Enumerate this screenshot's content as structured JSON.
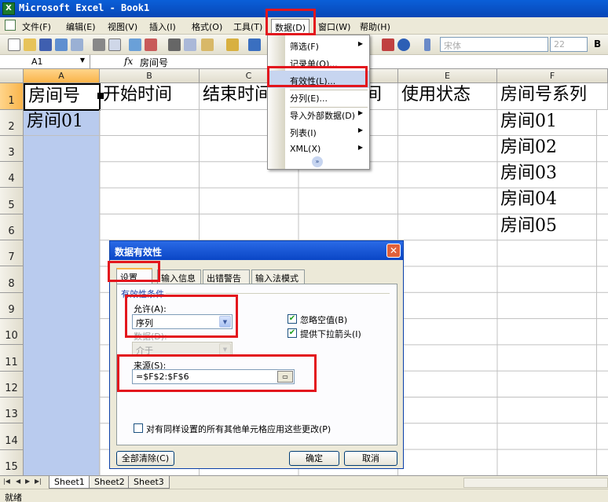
{
  "window": {
    "title": "Microsoft Excel - Book1",
    "app_icon": "X"
  },
  "menubar": {
    "items": [
      {
        "label": "文件(F)"
      },
      {
        "label": "编辑(E)"
      },
      {
        "label": "视图(V)"
      },
      {
        "label": "插入(I)"
      },
      {
        "label": "格式(O)"
      },
      {
        "label": "工具(T)"
      },
      {
        "label": "数据(D)"
      },
      {
        "label": "窗口(W)"
      },
      {
        "label": "帮助(H)"
      }
    ]
  },
  "toolbar": {
    "font_name": "宋体",
    "font_size": "22",
    "bold_label": "B"
  },
  "formula_bar": {
    "name_box": "A1",
    "fx_label": "fx",
    "content": "房间号"
  },
  "grid": {
    "columns": [
      "A",
      "B",
      "C",
      "D",
      "E",
      "F"
    ],
    "rows": [
      "1",
      "2",
      "3",
      "4",
      "5",
      "6",
      "7",
      "8",
      "9",
      "10",
      "11",
      "12",
      "13",
      "14",
      "15"
    ],
    "cells": {
      "A1": "房间号",
      "B1": "开始时间",
      "C1": "结束时间",
      "D1": "间",
      "E1": "使用状态",
      "F1": "房间号系列",
      "A2": "房间01",
      "F2": "房间01",
      "F3": "房间02",
      "F4": "房间03",
      "F5": "房间04",
      "F6": "房间05"
    }
  },
  "data_menu": {
    "items": [
      {
        "label": "筛选(F)",
        "submenu": true
      },
      {
        "label": "记录单(O)..."
      },
      {
        "label": "有效性(L)...",
        "highlighted": true
      },
      {
        "label": "分列(E)..."
      },
      {
        "label": "导入外部数据(D)",
        "submenu": true
      },
      {
        "label": "列表(I)",
        "submenu": true
      },
      {
        "label": "XML(X)",
        "submenu": true
      }
    ],
    "more_glyph": "»"
  },
  "dialog": {
    "title": "数据有效性",
    "close_glyph": "✕",
    "tabs": [
      "设置",
      "输入信息",
      "出错警告",
      "输入法模式"
    ],
    "active_tab": "设置",
    "group_label": "有效性条件",
    "allow_label": "允许(A):",
    "allow_value": "序列",
    "data_label": "数据(D):",
    "data_value": "介于",
    "ignore_blank_label": "忽略空值(B)",
    "ignore_blank_checked": true,
    "dropdown_arrow_label": "提供下拉箭头(I)",
    "dropdown_arrow_checked": true,
    "source_label": "来源(S):",
    "source_value": "=$F$2:$F$6",
    "apply_all_label": "对有同样设置的所有其他单元格应用这些更改(P)",
    "apply_all_checked": false,
    "clear_all_label": "全部清除(C)",
    "ok_label": "确定",
    "cancel_label": "取消"
  },
  "sheets": {
    "tabs": [
      "Sheet1",
      "Sheet2",
      "Sheet3"
    ],
    "active": "Sheet1"
  },
  "status": {
    "text": "就绪"
  },
  "colors": {
    "title_bar": "#0a5fd8",
    "highlight": "#e3161d",
    "selection": "#b9cbee",
    "chrome": "#ece9d8"
  }
}
